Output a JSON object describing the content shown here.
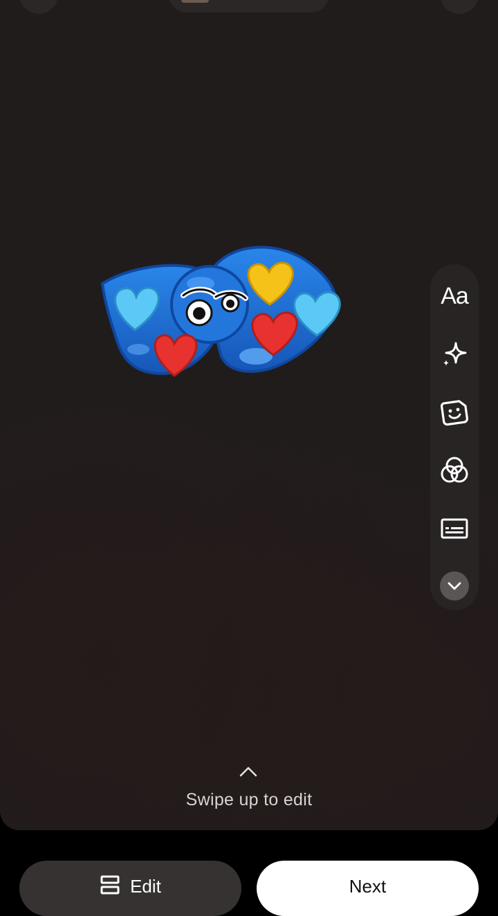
{
  "toolbar": {
    "text_tool_label": "Aa",
    "items": [
      "text-tool",
      "effects-sparkle-icon",
      "sticker-icon",
      "color-filter-icon",
      "caption-icon",
      "collapse-chevron-icon"
    ]
  },
  "hint": {
    "swipe_text": "Swipe up to edit"
  },
  "actions": {
    "edit_label": "Edit",
    "next_label": "Next"
  },
  "colors": {
    "background": "#201c1c",
    "toolbar": "#282424",
    "edit_button": "#363232",
    "next_button": "#ffffff",
    "sticker_blue": "#1f6fd6",
    "heart_red": "#e8322f",
    "heart_yellow": "#f5c21a",
    "heart_light_blue": "#5cc8f5"
  }
}
